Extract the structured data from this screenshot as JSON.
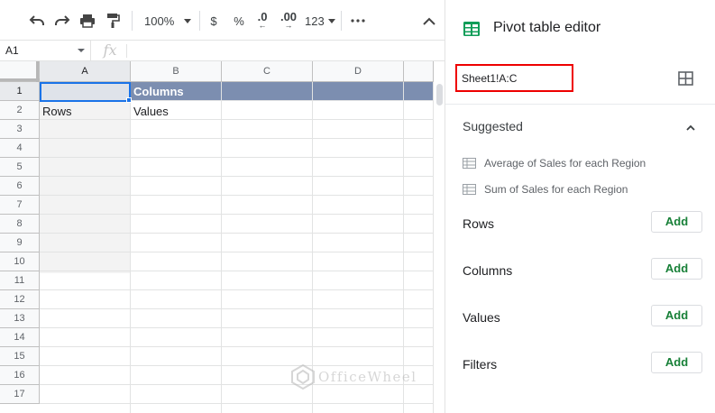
{
  "toolbar": {
    "zoom": "100%",
    "currency": "$",
    "percent": "%",
    "decrease_decimal": ".0",
    "increase_decimal": ".00",
    "number_format": "123"
  },
  "formula_bar": {
    "cell_ref": "A1",
    "fx": "fx"
  },
  "grid": {
    "columns": [
      "A",
      "B",
      "C",
      "D"
    ],
    "rows": [
      "1",
      "2",
      "3",
      "4",
      "5",
      "6",
      "7",
      "8",
      "9",
      "10",
      "11",
      "12",
      "13",
      "14",
      "15",
      "16",
      "17"
    ],
    "cells": {
      "b1": "Columns",
      "a2": "Rows",
      "b2": "Values"
    },
    "colors": {
      "header_band": "#7c8eb0",
      "selection": "#1a73e8"
    }
  },
  "watermark": {
    "text": "OfficeWheel"
  },
  "editor": {
    "title": "Pivot table editor",
    "range": "Sheet1!A:C",
    "suggested_label": "Suggested",
    "suggestions": [
      "Average of Sales for each Region",
      "Sum of Sales for each Region"
    ],
    "sections": [
      {
        "label": "Rows",
        "button": "Add"
      },
      {
        "label": "Columns",
        "button": "Add"
      },
      {
        "label": "Values",
        "button": "Add"
      },
      {
        "label": "Filters",
        "button": "Add"
      }
    ],
    "colors": {
      "accent_green": "#188038",
      "range_highlight": "#ee0000"
    }
  }
}
